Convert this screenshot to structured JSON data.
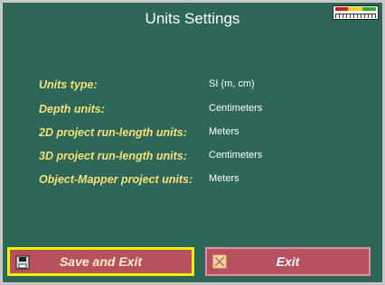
{
  "window": {
    "title": "Units Settings"
  },
  "fields": [
    {
      "label": "Units type:",
      "value": "SI (m, cm)"
    },
    {
      "label": "Depth units:",
      "value": "Centimeters"
    },
    {
      "label": "2D project run-length units:",
      "value": "Meters"
    },
    {
      "label": "3D project run-length units:",
      "value": "Centimeters"
    },
    {
      "label": "Object-Mapper project units:",
      "value": "Meters"
    }
  ],
  "buttons": {
    "save_exit": "Save and Exit",
    "exit": "Exit"
  },
  "icons": {
    "save": "floppy-disk-icon",
    "exit": "close-box-icon",
    "corner": "ruler-icon"
  },
  "colors": {
    "background": "#2e6658",
    "label": "#f5e17a",
    "button": "#b85060",
    "focus_border": "#f0f000"
  }
}
